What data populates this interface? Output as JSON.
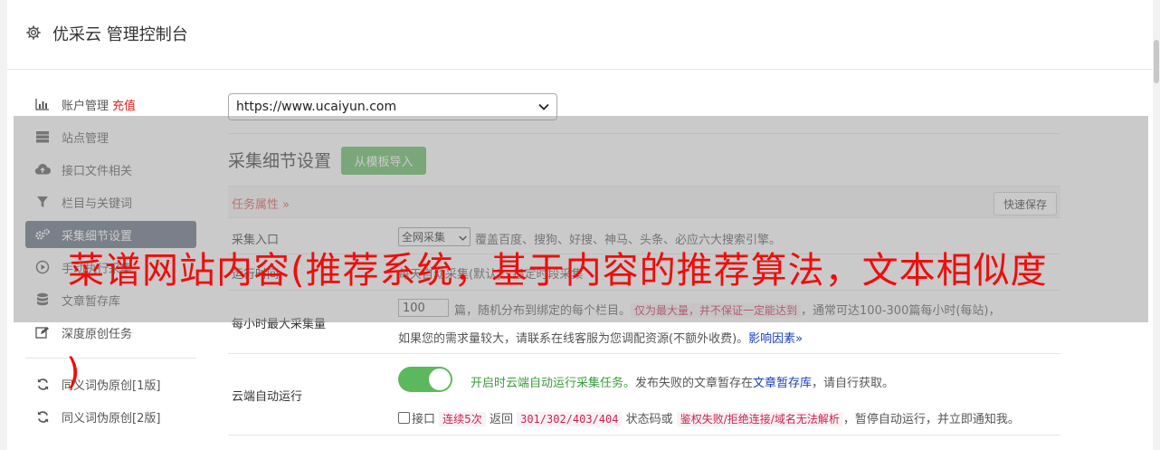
{
  "header": {
    "title": "优采云 管理控制台",
    "icon": "gear-icon"
  },
  "sidebar": {
    "items": [
      {
        "label": "账户管理",
        "badge": "充值",
        "icon": "bar-chart-icon"
      },
      {
        "label": "站点管理",
        "icon": "server-icon"
      },
      {
        "label": "接口文件相关",
        "icon": "cloud-upload-icon"
      },
      {
        "label": "栏目与关键词",
        "icon": "filter-icon"
      },
      {
        "label": "采集细节设置",
        "icon": "gears-icon",
        "active": true
      },
      {
        "label": "手动执行采集",
        "icon": "play-circle-icon"
      },
      {
        "label": "文章暂存库",
        "icon": "database-icon"
      },
      {
        "label": "深度原创任务",
        "icon": "edit-icon"
      },
      {
        "label": "同义词伪原创[1版]",
        "icon": "refresh-icon"
      },
      {
        "label": "同义词伪原创[2版]",
        "icon": "refresh-icon"
      }
    ]
  },
  "main": {
    "site_select": "https://www.ucaiyun.com",
    "section_title": "采集细节设置",
    "import_button": "从模板导入",
    "task_props": "任务属性 »",
    "quick_save": "快速保存",
    "entry": {
      "label": "采集入口",
      "select": "全网采集",
      "desc": "覆盖百度、搜狗、好搜、神马、头条、必应六大搜索引擎。"
    },
    "run_time": {
      "label": "运行时间",
      "desc": "每天自动采集(默认) · 指定时段采集"
    },
    "per_hour": {
      "label": "每小时最大采集量",
      "value": "100",
      "text1": "篇，随机分布到绑定的每个栏目。",
      "badge": "仅为最大量，并不保证一定能达到",
      "text2": "，通常可达100-300篇每小时(每站)，",
      "text3": "如果您的需求量较大，请联系在线客服为您调配资源(不额外收费)。",
      "link": "影响因素»"
    },
    "cloud_run": {
      "label": "云端自动运行",
      "text1": "开启时云端自动运行采集任务。",
      "text2": "发布失败的文章暂存在",
      "link": "文章暂存库",
      "text3": "，请自行获取。",
      "cb_label": "接口",
      "code1": "连续5次",
      "text4": "返回",
      "code2": "301/302/403/404",
      "text5": "状态码或",
      "code3": "鉴权失败/拒绝连接/域名无法解析",
      "text6": "，暂停自动运行，并立即通知我。"
    }
  },
  "overlay": {
    "line1": "菜谱网站内容(推荐系统，基于内容的推荐算法，文本相似度",
    "line2": ")"
  },
  "colors": {
    "accent_green": "#5cb85c",
    "active_nav": "#5f6b7c",
    "overlay_text": "#f00c0c"
  }
}
